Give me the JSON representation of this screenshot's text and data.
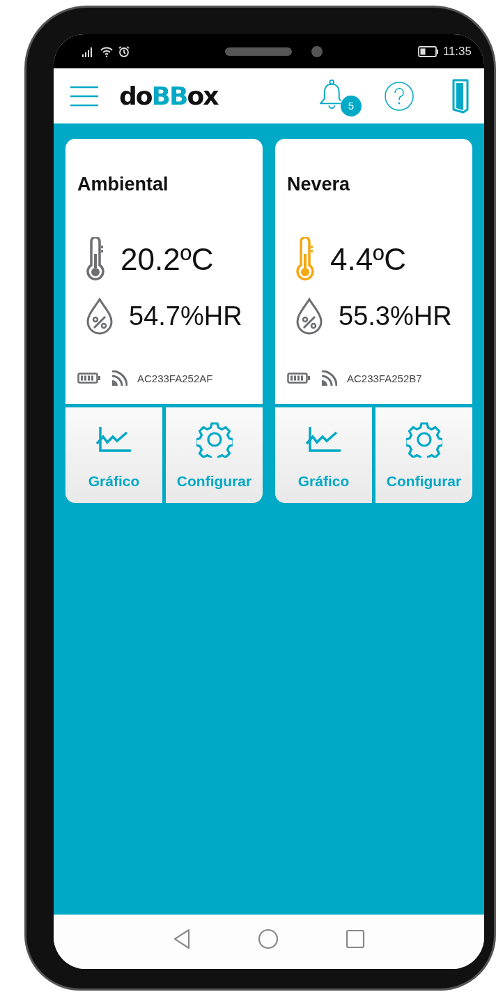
{
  "status_bar": {
    "time": "11:35"
  },
  "header": {
    "logo": [
      {
        "text": "do",
        "accent": false
      },
      {
        "text": "BB",
        "accent": true
      },
      {
        "text": "ox",
        "accent": false
      }
    ],
    "notification_count": "5"
  },
  "sensors": [
    {
      "name": "Ambiental",
      "temperature": "20.2ºC",
      "humidity": "54.7%HR",
      "device_id": "AC233FA252AF",
      "color": "#6d6e71",
      "actions": [
        "Gráfico",
        "Configurar"
      ]
    },
    {
      "name": "Nevera",
      "temperature": "4.4ºC",
      "humidity": "55.3%HR",
      "device_id": "AC233FA252B7",
      "color": "#f5a70f",
      "actions": [
        "Gráfico",
        "Configurar"
      ]
    }
  ]
}
